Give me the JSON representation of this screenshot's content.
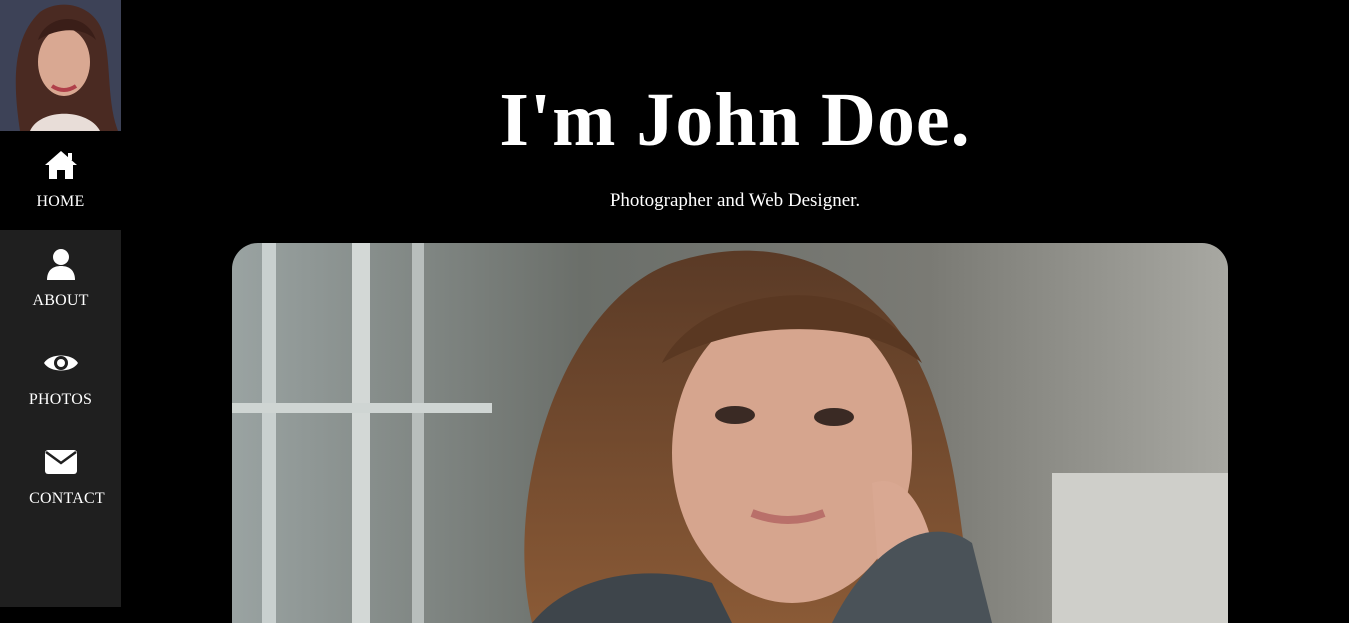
{
  "nav": {
    "items": [
      {
        "label": "HOME",
        "icon": "home-icon",
        "active": true
      },
      {
        "label": "ABOUT",
        "icon": "user-icon",
        "active": false
      },
      {
        "label": "PHOTOS",
        "icon": "eye-icon",
        "active": false
      },
      {
        "label": "CONTACT",
        "icon": "envelope-icon",
        "active": false
      }
    ]
  },
  "hero": {
    "title": "I'm John Doe.",
    "subtitle": "Photographer and Web Designer."
  },
  "colors": {
    "background": "#000000",
    "sidebar": "#1f1f1f",
    "text": "#ffffff"
  }
}
